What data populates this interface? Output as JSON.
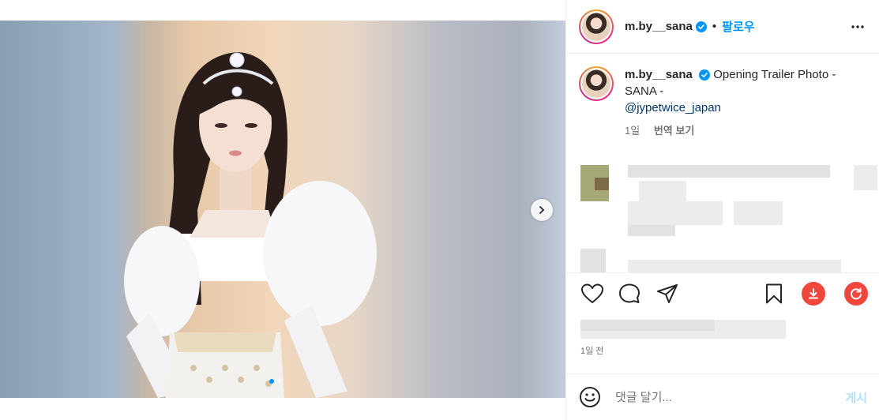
{
  "post": {
    "username": "m.by__sana",
    "follow_label": "팔로우",
    "separator": "•",
    "caption_text": " Opening Trailer Photo - SANA -",
    "mention": "@jypetwice_japan",
    "caption_age": "1일",
    "translate_label": "번역 보기",
    "posted_time": "1일 전",
    "comment_placeholder": "댓글 달기...",
    "post_label": "게시",
    "media_count": 2,
    "media_active_index": 0
  },
  "icons": {
    "verified": "verified-badge-icon",
    "more": "more-options-icon",
    "next": "chevron-right-icon",
    "like": "heart-icon",
    "comment": "comment-bubble-icon",
    "share": "paper-plane-icon",
    "save": "bookmark-icon",
    "download": "download-icon",
    "refresh": "refresh-icon",
    "emoji": "emoji-icon"
  },
  "colors": {
    "accent": "#0095f6",
    "mention": "#00376b",
    "download_button": "#f0463b",
    "refresh_button": "#f0463b",
    "muted_text": "#737373"
  }
}
